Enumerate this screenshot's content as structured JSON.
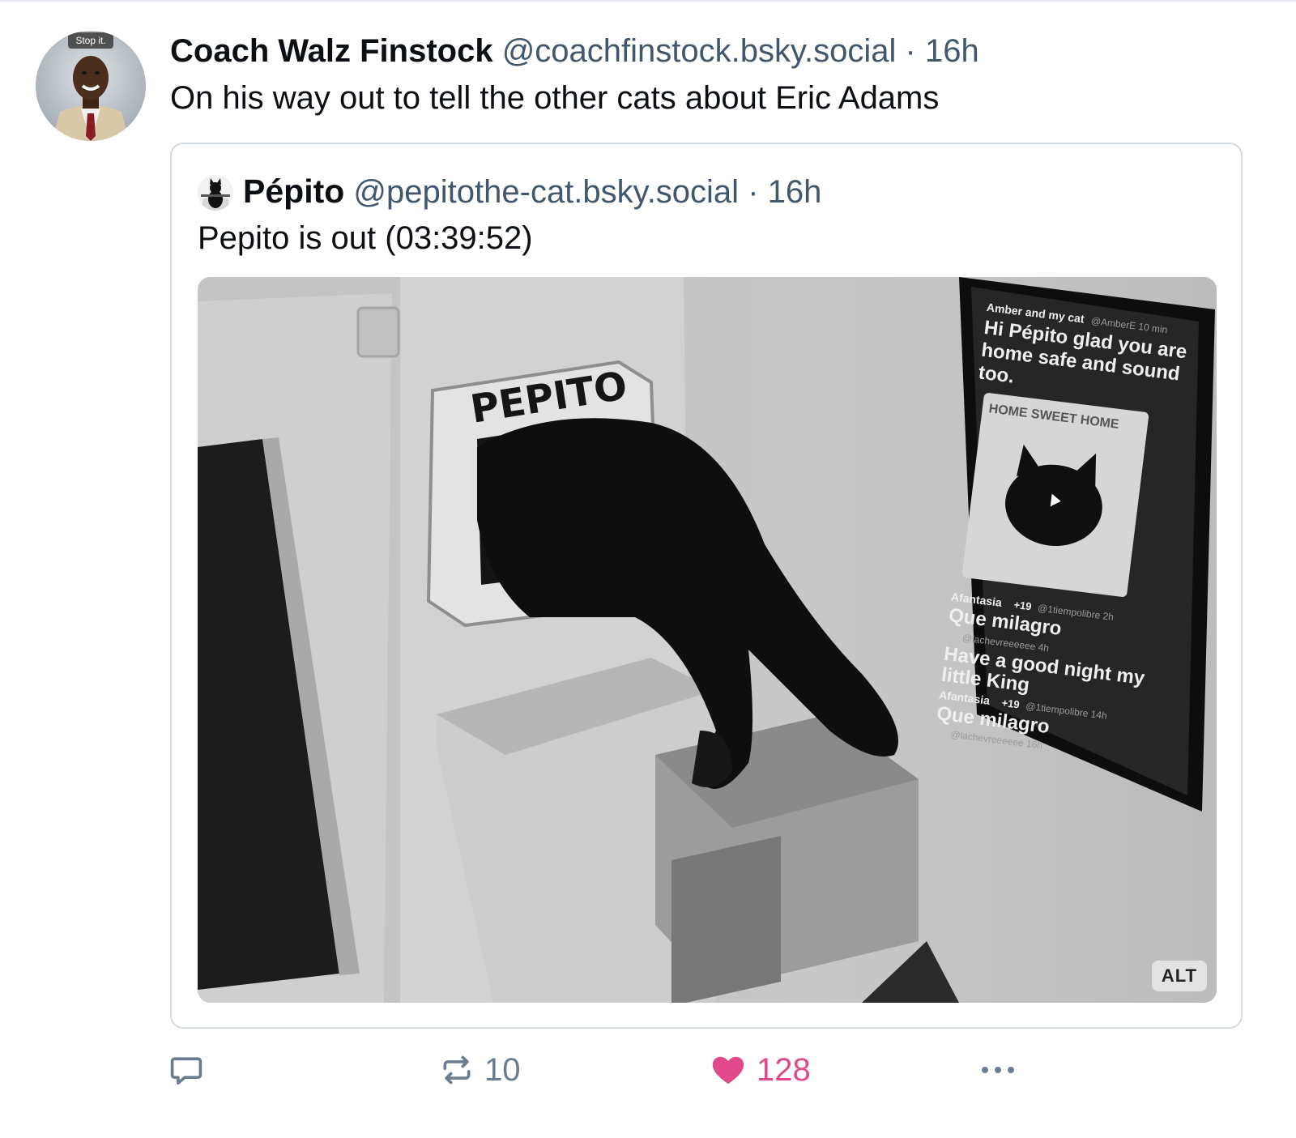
{
  "post": {
    "author": {
      "display_name": "Coach Walz Finstock",
      "handle": "@coachfinstock.bsky.social",
      "separator": "·",
      "time": "16h",
      "avatar_caption": "Stop it."
    },
    "text": "On his way out to tell the other cats about Eric Adams",
    "quote": {
      "author": {
        "display_name": "Pépito",
        "handle": "@pepitothe-cat.bsky.social",
        "separator": "·",
        "time": "16h"
      },
      "text": "Pepito is out (03:39:52)",
      "media": {
        "alt_badge": "ALT",
        "cat_flap_label": "PEPITO",
        "screen": {
          "name1": "Amber and my cat",
          "handle1": "@AmberE 10 min",
          "message1_lines": [
            "Hi Pépito glad you are",
            "home safe and sound",
            "too."
          ],
          "image_caption": "HOME SWEET HOME",
          "name2": "Afantasia",
          "badge2": "+19",
          "handle2": "@1tiempolibre 2h",
          "message2": "Que milagro",
          "handle3": "@lachevreeeeee 4h",
          "message3_lines": [
            "Have a good night my",
            "little King"
          ],
          "name4": "Afantasia",
          "badge4": "+19",
          "handle4": "@1tiempolibre 14h",
          "message4": "Que milagro",
          "handle5": "@lachevreeeeee 16h"
        }
      }
    },
    "actions": {
      "reply_count": "",
      "repost_count": "10",
      "like_count": "128"
    }
  },
  "colors": {
    "text": "#0b0f14",
    "secondary_text": "#42576c",
    "action_icon": "#6b7d8f",
    "like": "#e2498a",
    "border": "#d4dbe2"
  }
}
